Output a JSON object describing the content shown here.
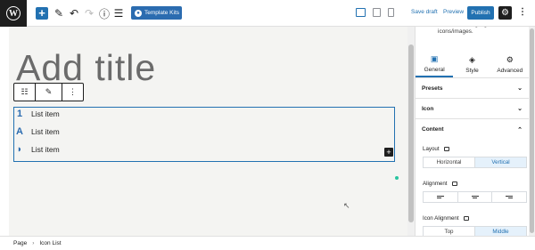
{
  "toolbar": {
    "logo_letter": "W",
    "add_symbol": "+",
    "template_kits_label": "Template Kits",
    "save_draft_label": "Save draft",
    "preview_label": "Preview",
    "publish_label": "Publish",
    "accent_color": "#2271b1"
  },
  "editor": {
    "title_placeholder": "Add title",
    "list_items": [
      {
        "icon": "1",
        "text": "List item"
      },
      {
        "icon": "A",
        "text": "List item"
      },
      {
        "icon": "◗",
        "text": "List item"
      }
    ],
    "inserter_symbol": "+"
  },
  "breadcrumb": {
    "items": [
      "Page",
      "Icon List"
    ],
    "separator": "›"
  },
  "sidebar": {
    "description": "Create a list highlighted with icons/images.",
    "tabs": [
      {
        "label": "General",
        "icon": "general-icon",
        "active": true
      },
      {
        "label": "Style",
        "icon": "paint-bucket-icon",
        "active": false
      },
      {
        "label": "Advanced",
        "icon": "gear-icon",
        "active": false
      }
    ],
    "panels": {
      "presets": "Presets",
      "icon": "Icon",
      "content": "Content"
    },
    "layout": {
      "label": "Layout",
      "options": [
        "Horizontal",
        "Vertical"
      ],
      "selected": "Vertical"
    },
    "alignment": {
      "label": "Alignment"
    },
    "icon_alignment": {
      "label": "Icon Alignment",
      "options": [
        "Top",
        "Middle"
      ],
      "selected": "Middle"
    }
  }
}
